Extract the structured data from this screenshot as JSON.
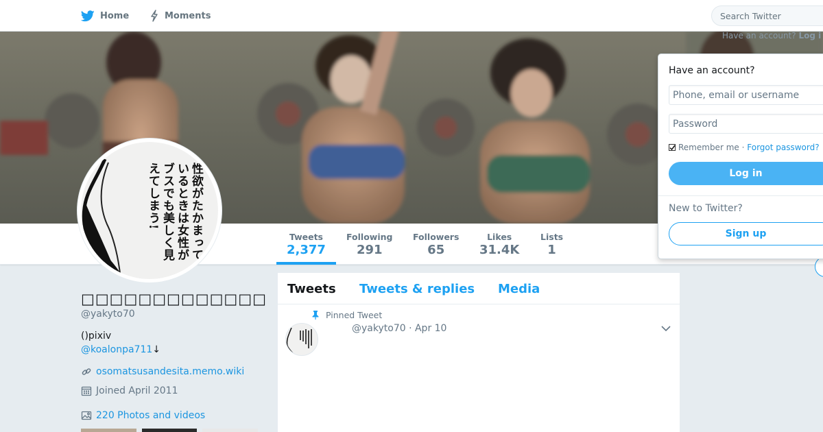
{
  "nav": {
    "home_label": "Home",
    "moments_label": "Moments",
    "search_placeholder": "Search Twitter",
    "have_account_prefix": "Have an account?",
    "have_account_login": "Log i"
  },
  "stats": {
    "tweets": {
      "label": "Tweets",
      "value": "2,377"
    },
    "following": {
      "label": "Following",
      "value": "291"
    },
    "followers": {
      "label": "Followers",
      "value": "65"
    },
    "likes": {
      "label": "Likes",
      "value": "31.4K"
    },
    "lists": {
      "label": "Lists",
      "value": "1"
    }
  },
  "avatar": {
    "text": "性欲がたかまっているときは女性がブスでも美しく見えてしまう!"
  },
  "profile": {
    "display_name": "□□□□□□□□□□□□□",
    "handle": "@yakyto70",
    "bio": "()pixiv",
    "bio_link": "@koalonpa711",
    "bio_link_suffix": "↓",
    "url": "osomatsusandesita.memo.wiki",
    "joined": "Joined April 2011",
    "photos": "220 Photos and videos"
  },
  "timeline": {
    "tabs": [
      "Tweets",
      "Tweets & replies",
      "Media"
    ],
    "pinned_label": "Pinned Tweet",
    "tweet_meta": "@yakyto70 · Apr 10"
  },
  "login": {
    "title": "Have an account?",
    "username_placeholder": "Phone, email or username",
    "password_placeholder": "Password",
    "remember": "Remember me",
    "separator": "·",
    "forgot": "Forgot password?",
    "login_button": "Log in",
    "new_to": "New to Twitter?",
    "signup_button": "Sign up"
  },
  "colors": {
    "accent": "#1da1f2",
    "link": "#1b95e0",
    "login_button": "#4ab3f4",
    "background": "#e6ecf0"
  }
}
